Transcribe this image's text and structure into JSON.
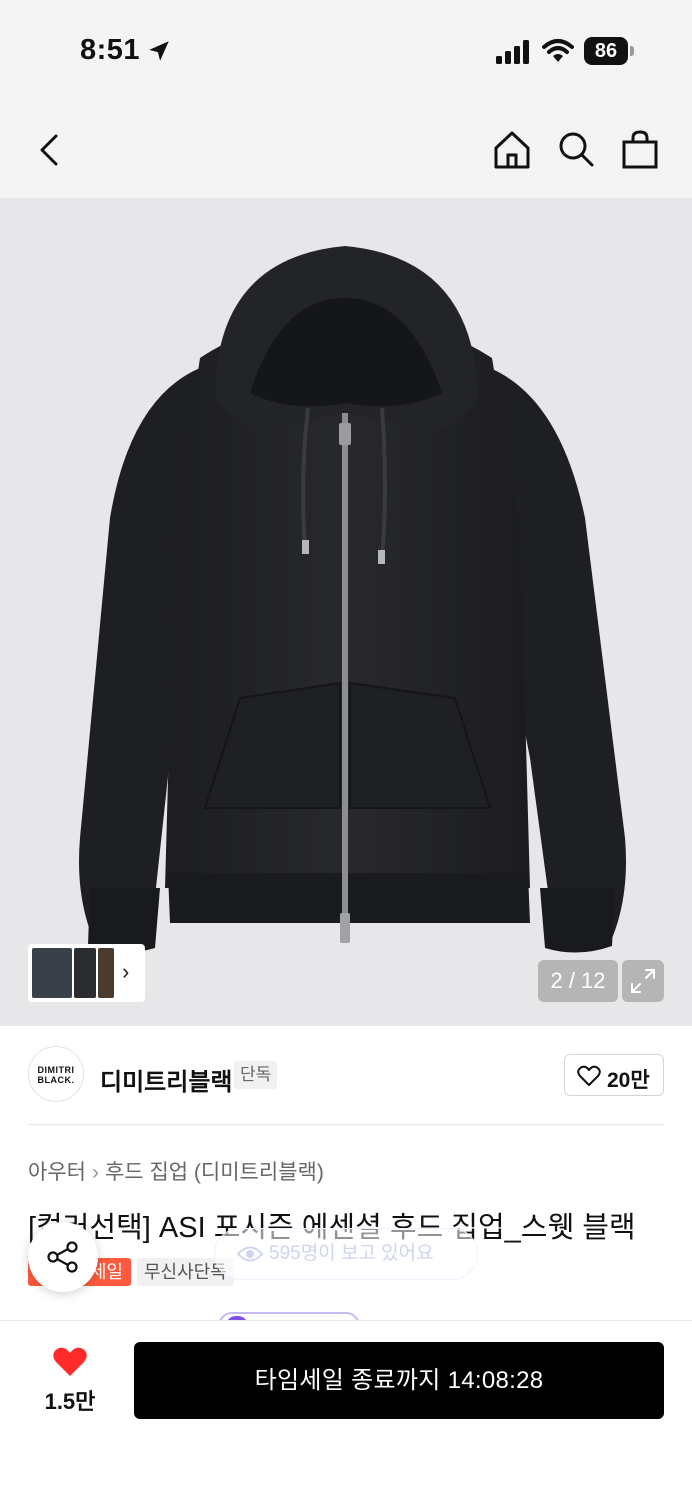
{
  "status_bar": {
    "time": "8:51",
    "battery": "86",
    "icons": [
      "location-arrow-icon",
      "cellular-signal-icon",
      "wifi-icon",
      "battery-icon"
    ]
  },
  "nav": {
    "icons": [
      "back-chevron-icon",
      "home-icon",
      "search-icon",
      "shopping-bag-icon"
    ]
  },
  "gallery": {
    "counter": "2 / 12",
    "thumb_chevron": "›",
    "icons": [
      "expand-icon"
    ]
  },
  "brand": {
    "logo_text": "DIMITRI BLACK.",
    "name": "디미트리블랙",
    "tag": "단독",
    "like_count": "20만"
  },
  "product": {
    "breadcrumb": [
      "아우터",
      "후드 집업 (디미트리블랙)"
    ],
    "breadcrumb_sep": "›",
    "title": "[컬러선택] ASI 포시즌 에센셜 후드 집업_스웻 블랙",
    "badges": {
      "sale": "세일",
      "exclusive": "무신사단독"
    },
    "viewers": "595명이 보고 있어요"
  },
  "bottom": {
    "wish_count": "1.5만",
    "buy_label": "타임세일 종료까지 14:08:28"
  },
  "colors": {
    "accent_red": "#ff3b3b",
    "sale_badge": "#ff5a3d",
    "cta_black": "#000000"
  }
}
